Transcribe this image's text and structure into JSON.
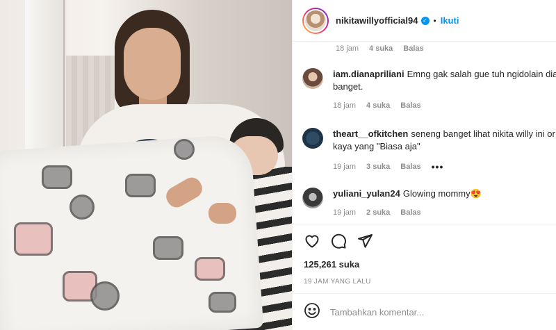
{
  "post": {
    "username": "nikitawillyofficial94",
    "verified": true,
    "follow_label": "Ikuti",
    "dot": "•"
  },
  "first_meta": {
    "time": "18 jam",
    "likes": "4 suka",
    "reply": "Balas"
  },
  "comments": [
    {
      "username": "iam.dianapriliani",
      "text": "Emng gak salah gue tuh ngidolain dia",
      "text_line2": "banget.",
      "time": "18 jam",
      "likes": "4 suka",
      "reply": "Balas"
    },
    {
      "username": "theart__ofkitchen",
      "text": "seneng banget lihat nikita willy ini or",
      "text_line2": "kaya yang \"Biasa aja\"",
      "time": "19 jam",
      "likes": "3 suka",
      "reply": "Balas",
      "more": "•••"
    },
    {
      "username": "yuliani_yulan24",
      "text": "Glowing mommy",
      "emoji": "😍",
      "time": "19 jam",
      "likes": "2 suka",
      "reply": "Balas"
    }
  ],
  "likes_count": "125,261 suka",
  "timestamp": "19 JAM YANG LALU",
  "comment_input": {
    "placeholder": "Tambahkan komentar..."
  },
  "colors": {
    "accent": "#0095f6",
    "text": "#262626",
    "muted": "#8e8e8e"
  },
  "icons": [
    "heart-icon",
    "comment-icon",
    "share-icon",
    "emoji-icon",
    "verified-icon"
  ]
}
